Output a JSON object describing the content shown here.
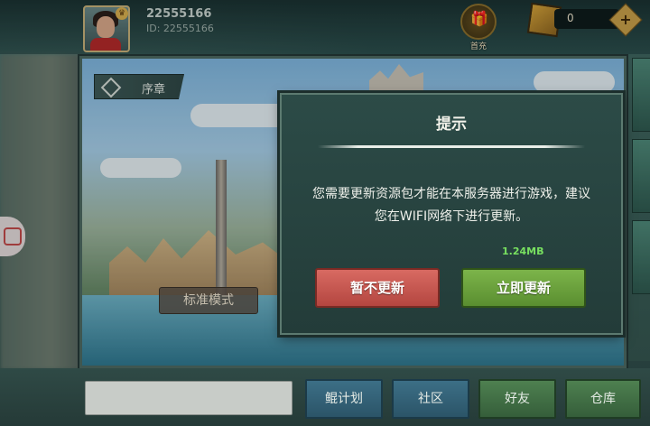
{
  "player": {
    "name": "22555166",
    "id_label": "ID: 22555166"
  },
  "topbar": {
    "recharge_label": "首充",
    "gems_value": "0",
    "plus_label": "+"
  },
  "chapter": {
    "label": "序章"
  },
  "mode": {
    "label": "标准模式"
  },
  "dialog": {
    "title": "提示",
    "message": "您需要更新资源包才能在本服务器进行游戏，建议您在WIFI网络下进行更新。",
    "size": "1.24MB",
    "cancel_label": "暂不更新",
    "confirm_label": "立即更新"
  },
  "bottom_nav": {
    "items": [
      {
        "label": "鲲计划"
      },
      {
        "label": "社区"
      },
      {
        "label": "好友"
      },
      {
        "label": "仓库"
      }
    ]
  }
}
